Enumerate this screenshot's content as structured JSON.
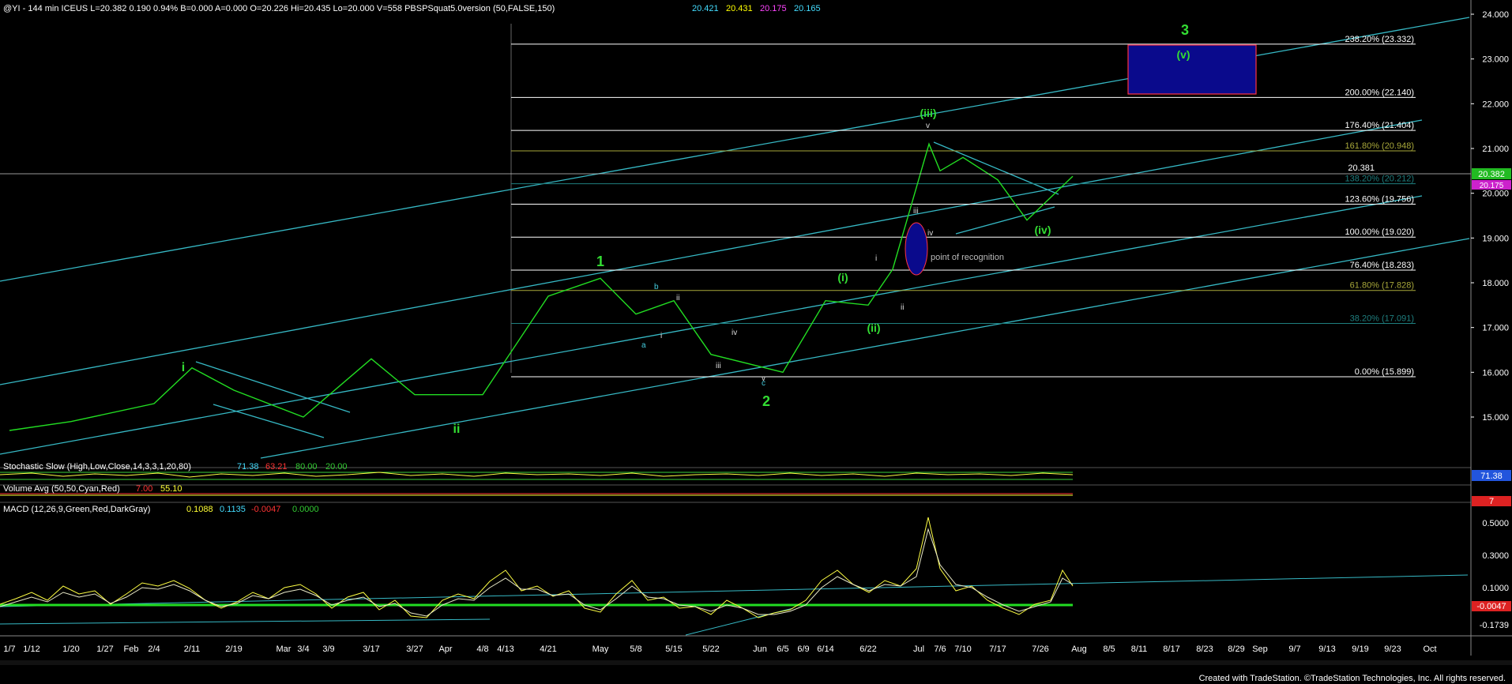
{
  "header": {
    "symbol_text": "@YI - 144 min  ICEUS  L=20.382  0.190  0.94%  B=0.000  A=0.000  O=20.226  Hi=20.435  Lo=20.000  V=558  PBSPSquat5.0version (50,FALSE,150)",
    "v1": "20.421",
    "v2": "20.431",
    "v3": "20.175",
    "v4": "20.165",
    "v1_color": "#44ddff",
    "v2_color": "#ffff00",
    "v3_color": "#ff44ff",
    "v4_color": "#44ddff"
  },
  "price_axis": {
    "ticks": [
      "24.000",
      "23.000",
      "22.000",
      "21.000",
      "20.000",
      "19.000",
      "18.000",
      "17.000",
      "16.000",
      "15.000"
    ],
    "last": "20.382",
    "last2": "20.175"
  },
  "fib_levels": [
    {
      "label": "238.20% (23.332)",
      "value": 23.332,
      "color": "#ffffff"
    },
    {
      "label": "200.00% (22.140)",
      "value": 22.14,
      "color": "#ffffff"
    },
    {
      "label": "176.40% (21.404)",
      "value": 21.404,
      "color": "#ffffff"
    },
    {
      "label": "161.80% (20.948)",
      "value": 20.948,
      "color": "#a8a83a"
    },
    {
      "label": "138.20% (20.212)",
      "value": 20.212,
      "color": "#1f7f7f"
    },
    {
      "label": "123.60% (19.756)",
      "value": 19.756,
      "color": "#ffffff"
    },
    {
      "label": "100.00% (19.020)",
      "value": 19.02,
      "color": "#ffffff"
    },
    {
      "label": "76.40% (18.283)",
      "value": 18.283,
      "color": "#ffffff"
    },
    {
      "label": "61.80% (17.828)",
      "value": 17.828,
      "color": "#a8a83a"
    },
    {
      "label": "38.20% (17.091)",
      "value": 17.091,
      "color": "#1f7f7f"
    },
    {
      "label": "0.00% (15.899)",
      "value": 15.899,
      "color": "#ffffff"
    }
  ],
  "price_marker": "20.381",
  "annotations": {
    "point_of_recognition": "point of recognition",
    "wave_3": "3",
    "wave_v": "(v)",
    "wave_iii_big": "(iii)",
    "wave_iv_big": "(iv)",
    "wave_i_circ": "(i)",
    "wave_ii_circ": "(ii)",
    "wave_1": "1",
    "wave_2": "2",
    "wave_i": "i",
    "wave_ii": "ii",
    "wave_a": "a",
    "wave_b": "b",
    "wave_c": "c",
    "wave_iii_small": "iii",
    "wave_iv_small": "iv",
    "wave_v_small": "v",
    "roman_i": "i",
    "roman_ii": "ii",
    "roman_iii": "iii",
    "roman_iv": "iv",
    "roman_v": "v",
    "i_label": "i",
    "ii_label": "ii",
    "iii_label": "iii",
    "iv_label": "iv",
    "v_label": "v"
  },
  "stochastic": {
    "label": "Stochastic Slow (High,Low,Close,14,3,3,1,20,80)",
    "v1": "71.38",
    "v2": "63.21",
    "v3": "80.00",
    "v4": "20.00",
    "axis": "71.38"
  },
  "volume": {
    "label": "Volume Avg (50,50,Cyan,Red)",
    "v1": "7.00",
    "v2": "55.10",
    "axis": "7"
  },
  "macd": {
    "label": "MACD (12,26,9,Green,Red,DarkGray)",
    "v1": "0.1088",
    "v2": "0.1135",
    "v3": "-0.0047",
    "v4": "0.0000",
    "ticks": [
      "0.5000",
      "0.3000",
      "0.1000",
      "-0.1739"
    ],
    "last": "-0.0047"
  },
  "x_axis": {
    "labels": [
      "1/7",
      "1/12",
      "1/20",
      "1/27",
      "Feb",
      "2/4",
      "2/11",
      "2/19",
      "Mar",
      "3/4",
      "3/9",
      "3/17",
      "3/27",
      "Apr",
      "4/8",
      "4/13",
      "4/21",
      "May",
      "5/8",
      "5/15",
      "5/22",
      "Jun",
      "6/5",
      "6/9",
      "6/14",
      "6/22",
      "Jul",
      "7/6",
      "7/10",
      "7/17",
      "7/26",
      "Aug",
      "8/5",
      "8/11",
      "8/17",
      "8/23",
      "8/29",
      "Sep",
      "9/7",
      "9/13",
      "9/19",
      "9/23",
      "Oct"
    ]
  },
  "footer": "Created with TradeStation. ©TradeStation Technologies, Inc. All rights reserved.",
  "chart_data": {
    "type": "line",
    "ylim": [
      14.5,
      24.2
    ],
    "series": [
      {
        "x": [
          "1/7",
          "1/20",
          "2/4",
          "2/11",
          "2/19",
          "3/4",
          "3/17",
          "3/27",
          "4/8",
          "4/21",
          "5/1",
          "5/8",
          "5/15",
          "5/22",
          "6/5",
          "6/14",
          "6/22",
          "6/28",
          "7/3",
          "7/6",
          "7/10",
          "7/17",
          "7/24",
          "7/28"
        ],
        "values": [
          14.7,
          14.9,
          15.3,
          16.1,
          15.6,
          15.0,
          16.3,
          15.5,
          15.5,
          17.7,
          18.1,
          17.3,
          17.6,
          16.4,
          16.0,
          17.6,
          17.5,
          18.3,
          21.1,
          20.5,
          20.8,
          20.3,
          19.4,
          20.38
        ]
      }
    ]
  }
}
